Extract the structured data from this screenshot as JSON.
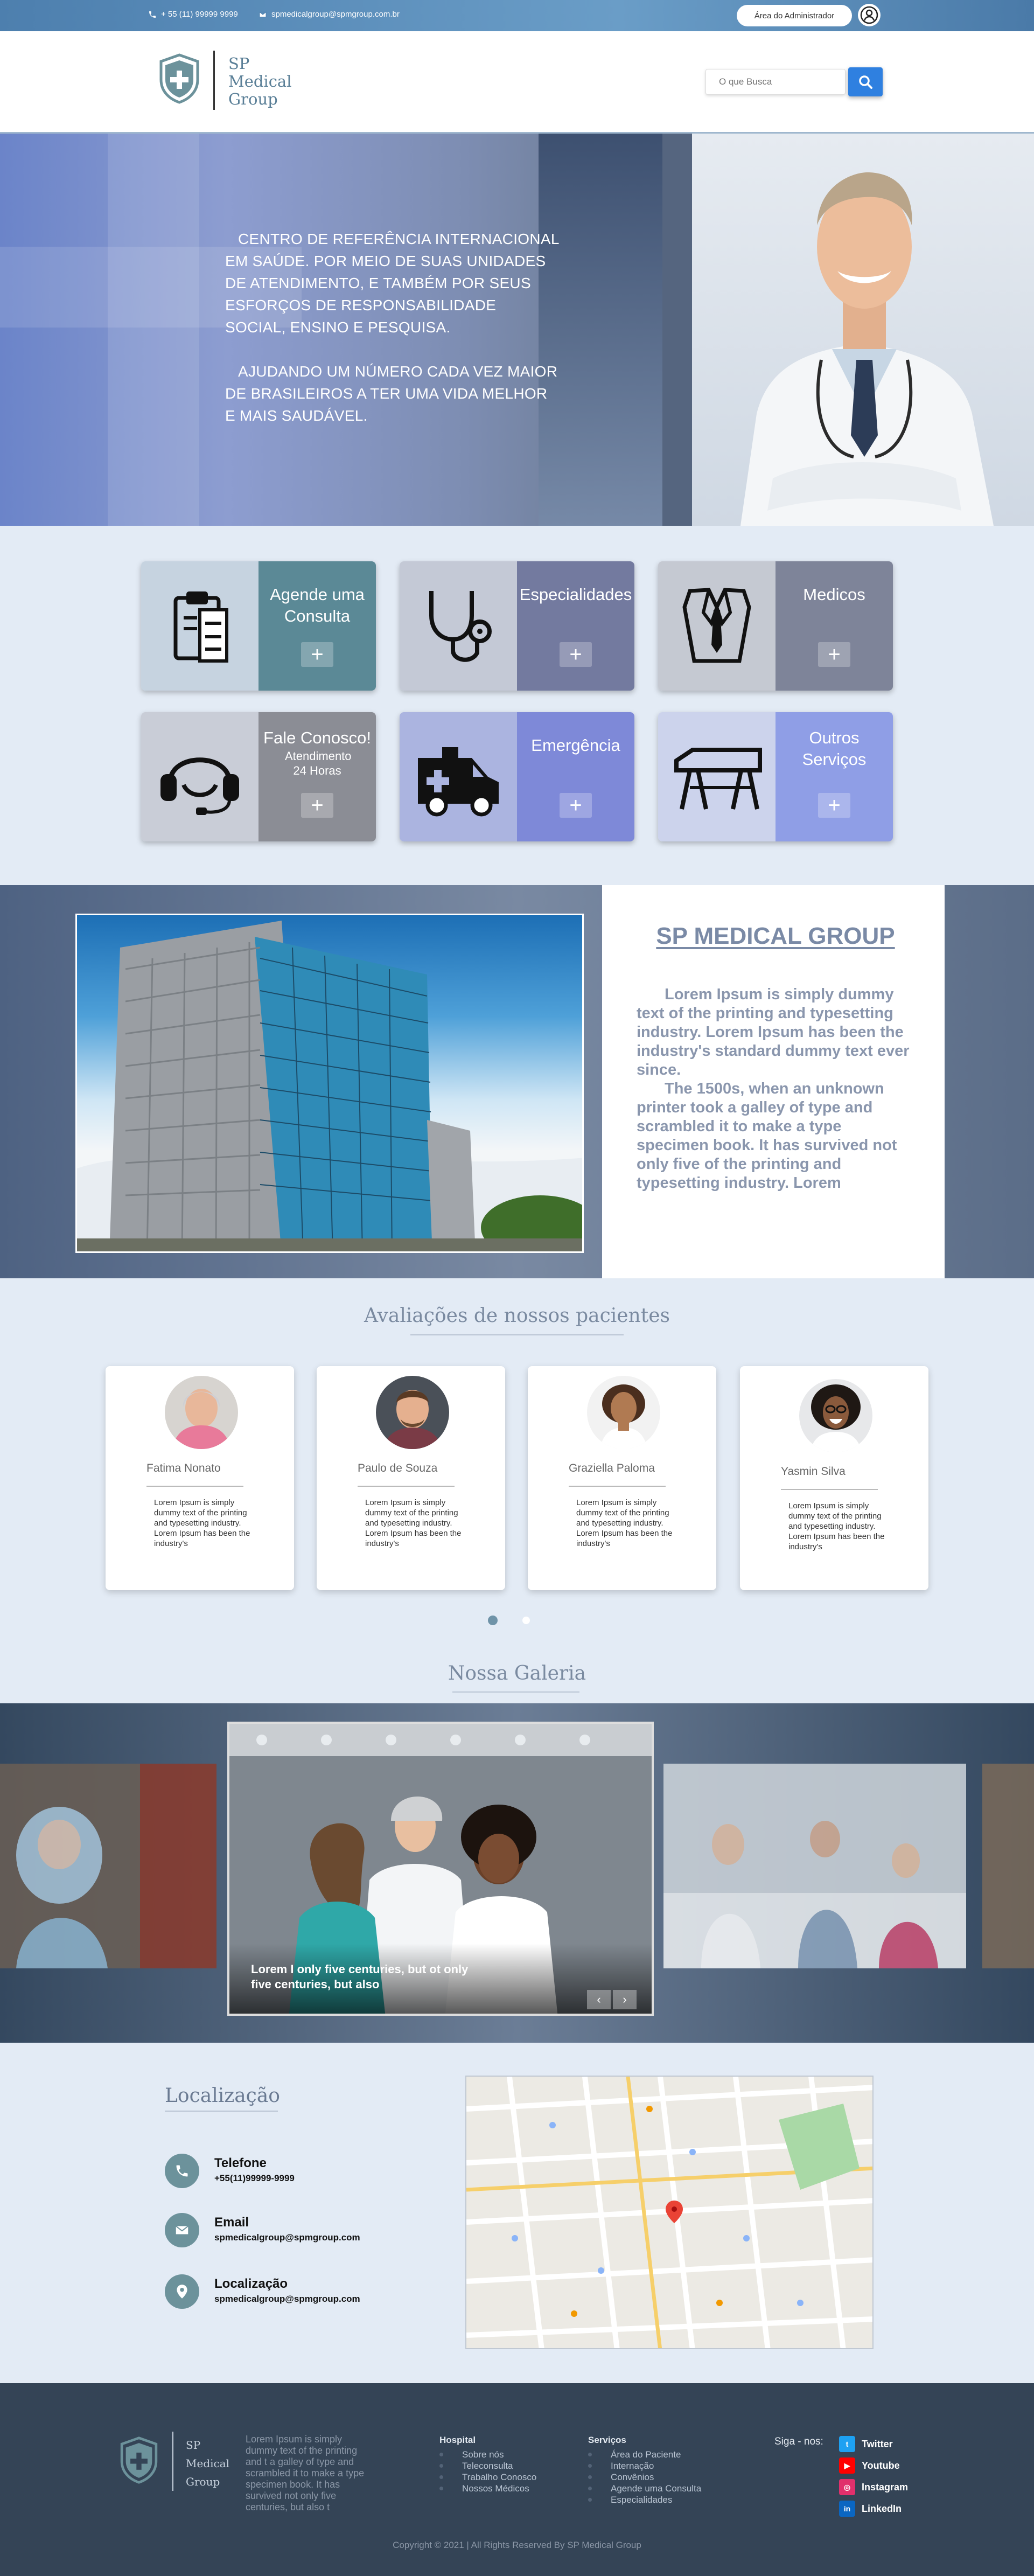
{
  "topbar": {
    "phone": "+ 55 (11) 99999 9999",
    "email": "spmedicalgroup@spmgroup.com.br",
    "admin_button": "Área do Administrador"
  },
  "header": {
    "logo_line1": "SP",
    "logo_line2": "Medical",
    "logo_line3": "Group",
    "search_placeholder": "O que Busca"
  },
  "hero": {
    "paragraph1": "Centro de referência internacional em saúde.  Por meio de suas unidades de atendimento, e também por seus esforços de responsabilidade social, ensino e pesquisa.",
    "paragraph2": "Ajudando um número cada vez maior de brasileiros a ter uma vida melhor e mais saudável."
  },
  "services": [
    {
      "label": "Agende uma Consulta",
      "sub": "",
      "icon": "clipboard-icon"
    },
    {
      "label": "Especialidades",
      "sub": "",
      "icon": "stethoscope-icon"
    },
    {
      "label": "Medicos",
      "sub": "",
      "icon": "doctor-coat-icon"
    },
    {
      "label": "Fale Conosco!",
      "sub": "Atendimento 24 Horas",
      "icon": "headset-icon"
    },
    {
      "label": "Emergência",
      "sub": "",
      "icon": "ambulance-icon"
    },
    {
      "label": "Outros Serviços",
      "sub": "",
      "icon": "stretcher-icon"
    }
  ],
  "about": {
    "title": "SP MEDICAL GROUP",
    "paragraph1": "Lorem Ipsum is simply dummy text of the printing and typesetting industry. Lorem Ipsum has been the industry's standard dummy text ever since.",
    "paragraph2": "The 1500s, when an unknown printer took a galley of type and scrambled it to make a type specimen book. It has survived not only five  of the printing and typesetting industry. Lorem"
  },
  "reviews": {
    "title": "Avaliações de nossos pacientes",
    "items": [
      {
        "name": "Fatima Nonato",
        "text": "Lorem Ipsum is simply dummy text of the printing and typesetting industry. Lorem Ipsum has been the industry's"
      },
      {
        "name": "Paulo de Souza",
        "text": "Lorem Ipsum is simply dummy text of the printing and typesetting industry. Lorem Ipsum has been the industry's"
      },
      {
        "name": "Graziella Paloma",
        "text": "Lorem Ipsum is simply dummy text of the printing and typesetting industry. Lorem Ipsum has been the industry's"
      },
      {
        "name": "Yasmin Silva",
        "text": "Lorem Ipsum is simply dummy text of the printing and typesetting industry. Lorem Ipsum has been the industry's"
      }
    ]
  },
  "gallery": {
    "title": "Nossa Galeria",
    "caption": "Lorem I only five centuries, but ot only five centuries, but also",
    "prev": "‹",
    "next": "›"
  },
  "location": {
    "title": "Localização",
    "phone_label": "Telefone",
    "phone_value": "+55(11)99999-9999",
    "email_label": "Email",
    "email_value": "spmedicalgroup@spmgroup.com",
    "address_label": "Localização",
    "address_value": "spmedicalgroup@spmgroup.com"
  },
  "footer": {
    "logo_line1": "SP",
    "logo_line2": "Medical",
    "logo_line3": "Group",
    "about": "Lorem Ipsum is simply dummy text of the printing and t a galley of type and scrambled it to make a type specimen book. It has survived not only five centuries, but also t",
    "hospital_title": "Hospital",
    "hospital_links": [
      "Sobre nós",
      "Teleconsulta",
      "Trabalho Conosco",
      "Nossos Médicos"
    ],
    "services_title": "Serviços",
    "services_links": [
      "Área do Paciente",
      "Internação",
      "Convênios",
      "Agende uma Consulta",
      "Especialidades"
    ],
    "social_title": "Siga - nos:",
    "social": [
      {
        "label": "Twitter",
        "color": "#1da1f2"
      },
      {
        "label": "Youtube",
        "color": "#ff0000"
      },
      {
        "label": "Instagram",
        "color": "#e1306c"
      },
      {
        "label": "LinkedIn",
        "color": "#0a66c2"
      }
    ],
    "copyright": "Copyright © 2021 | All Rights Reserved By SP Medical Group"
  },
  "colors": {
    "accent": "#2f80e0",
    "brand_teal": "#6c929b",
    "footer_bg": "#344456"
  }
}
